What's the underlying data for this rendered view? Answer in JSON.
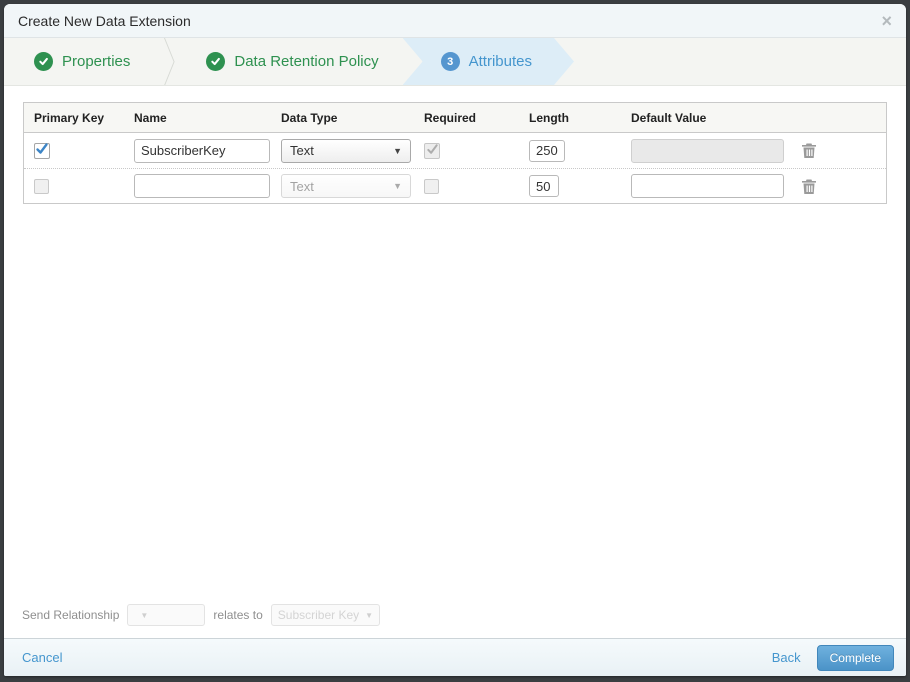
{
  "dialog": {
    "title": "Create New Data Extension",
    "close_icon": "×"
  },
  "wizard": {
    "steps": [
      {
        "label": "Properties",
        "status": "complete"
      },
      {
        "label": "Data Retention Policy",
        "status": "complete"
      },
      {
        "label": "Attributes",
        "status": "active",
        "number": "3"
      }
    ]
  },
  "table": {
    "headers": [
      "Primary Key",
      "Name",
      "Data Type",
      "Required",
      "Length",
      "Default Value"
    ],
    "rows": [
      {
        "primary_key_checked": true,
        "name": "SubscriberKey",
        "data_type": "Text",
        "data_type_disabled": false,
        "required_checked": true,
        "required_disabled": true,
        "length": "250",
        "default_value": "",
        "default_disabled": true
      },
      {
        "primary_key_checked": false,
        "name": "",
        "data_type": "Text",
        "data_type_disabled": true,
        "required_checked": false,
        "required_disabled": false,
        "length": "50",
        "default_value": "",
        "default_disabled": false
      }
    ]
  },
  "send_relationship": {
    "label": "Send Relationship",
    "relates_to_label": "relates to",
    "target_field": "Subscriber Key",
    "caret": "▾"
  },
  "footer": {
    "cancel_label": "Cancel",
    "back_label": "Back",
    "complete_label": "Complete"
  },
  "colors": {
    "accent_green": "#2e9150",
    "accent_blue": "#4596ce",
    "active_step_bg": "#ddedf7",
    "button_blue": "#4b93c8"
  }
}
